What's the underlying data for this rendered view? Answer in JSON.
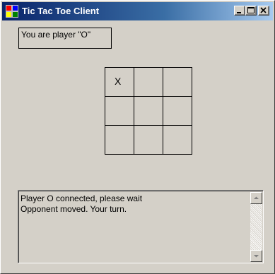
{
  "window": {
    "title": "Tic Tac Toe Client",
    "controls": {
      "minimize_icon": "minimize-icon",
      "maximize_icon": "maximize-icon",
      "close_icon": "close-icon"
    },
    "app_icon": "app-icon"
  },
  "player_label": "You are player \"O\"",
  "board": {
    "cells": [
      "X",
      "",
      "",
      "",
      "",
      "",
      "",
      "",
      ""
    ]
  },
  "log": {
    "lines": [
      "Player O connected, please wait",
      "Opponent moved.  Your turn."
    ]
  },
  "scrollbar": {
    "up_icon": "scroll-up-arrow-icon",
    "down_icon": "scroll-down-arrow-icon"
  },
  "colors": {
    "titlebar_start": "#0a246a",
    "titlebar_end": "#a6caf0",
    "window_bg": "#d4d0c8"
  }
}
